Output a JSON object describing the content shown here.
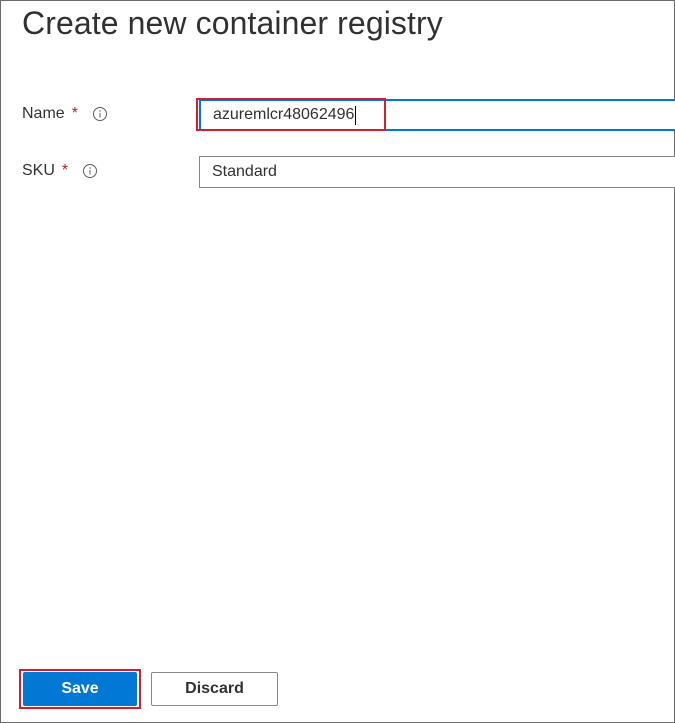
{
  "dialog": {
    "title": "Create new container registry"
  },
  "form": {
    "name": {
      "label": "Name",
      "required_marker": "*",
      "value": "azuremlcr48062496"
    },
    "sku": {
      "label": "SKU",
      "required_marker": "*",
      "value": "Standard"
    }
  },
  "actions": {
    "save_label": "Save",
    "discard_label": "Discard"
  },
  "colors": {
    "primary": "#0078d4",
    "required": "#a4262c",
    "highlight": "#d0202f",
    "text": "#323130"
  },
  "icons": {
    "info": "info-circle-icon"
  }
}
